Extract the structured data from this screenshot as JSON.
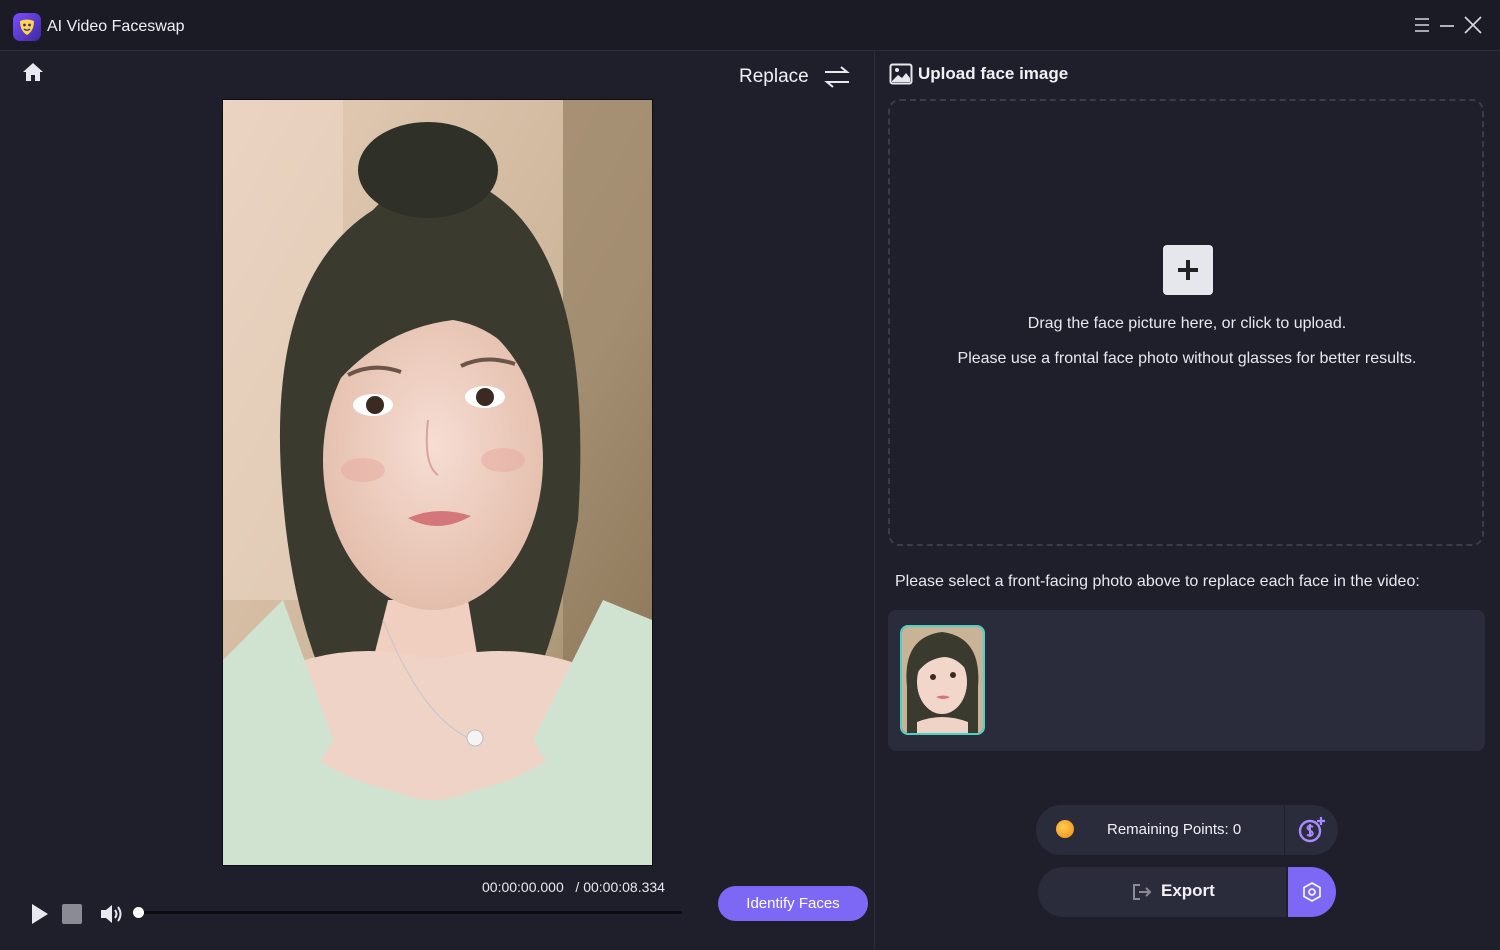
{
  "app": {
    "title": "AI Video Faceswap"
  },
  "window_controls": [
    "menu-icon",
    "minimize-icon",
    "close-icon"
  ],
  "player": {
    "mode_label": "Replace",
    "current_time": "00:00:00.000",
    "total_time": "/ 00:00:08.334",
    "progress": 0,
    "identify_label": "Identify Faces"
  },
  "upload": {
    "header": "Upload face image",
    "hint_line1": "Drag the face picture here, or click to upload.",
    "hint_line2": "Please use a frontal face photo without glasses for better results."
  },
  "faces": {
    "instruction": "Please select a front-facing photo above to replace each face in the video:",
    "count": 1
  },
  "points": {
    "label": "Remaining Points: 0"
  },
  "export": {
    "label": "Export"
  },
  "colors": {
    "accent": "#7d67f5",
    "face_border": "#4fd1c5",
    "background": "#1e1f2b"
  }
}
